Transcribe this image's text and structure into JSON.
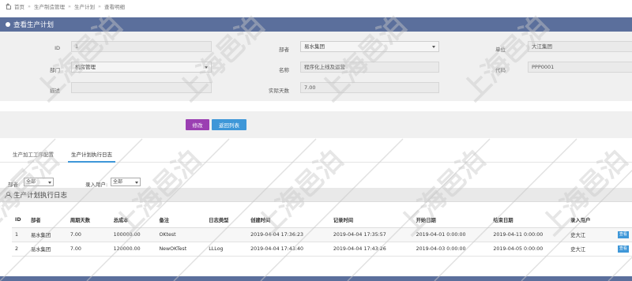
{
  "breadcrumb": [
    "首页",
    "生产制造管理",
    "生产计划",
    "查看明细"
  ],
  "panel_title": "查看生产计划",
  "form": {
    "id_label": "ID",
    "id_value": "1",
    "group_label": "部者",
    "group_value": "易水集团",
    "unit_label": "单位",
    "unit_value": "大江集团",
    "dept_label": "部门",
    "dept_value": "机房管理",
    "name_label": "名称",
    "name_value": "程序化上线及运营",
    "code_label": "代码",
    "code_value": "PPP0001",
    "desc_label": "描述",
    "desc_value": "",
    "days_label": "实际天数",
    "days_value": "7.00"
  },
  "buttons": {
    "edit": "修改",
    "back": "返回列表"
  },
  "tabs": [
    "生产加工工序配置",
    "生产计划执行日志"
  ],
  "filters": {
    "group_label": "部者:",
    "group_value": "全部",
    "user_label": "录入用户:",
    "user_value": "全部"
  },
  "log_title": "生产计划执行日志",
  "table": {
    "headers": [
      "ID",
      "部者",
      "周期天数",
      "总成本",
      "备注",
      "日志类型",
      "创建时间",
      "记录时间",
      "开始日期",
      "结束日期",
      "录入用户",
      ""
    ],
    "rows": [
      [
        "1",
        "易水集团",
        "7.00",
        "100000.00",
        "OKtest",
        "",
        "2019-04-04 17:36:23",
        "2019-04-04 17:35:57",
        "2019-04-01 0:00:00",
        "2019-04-11 0:00:00",
        "史大江",
        "查看"
      ],
      [
        "2",
        "易水集团",
        "7.00",
        "120000.00",
        "NewOKTest",
        "LLLog",
        "2019-04-04 17:43:40",
        "2019-04-04 17:43:26",
        "2019-04-03 0:00:00",
        "2019-04-05 0:00:00",
        "史大江",
        "查看"
      ]
    ]
  },
  "watermark": "上海邑泊"
}
